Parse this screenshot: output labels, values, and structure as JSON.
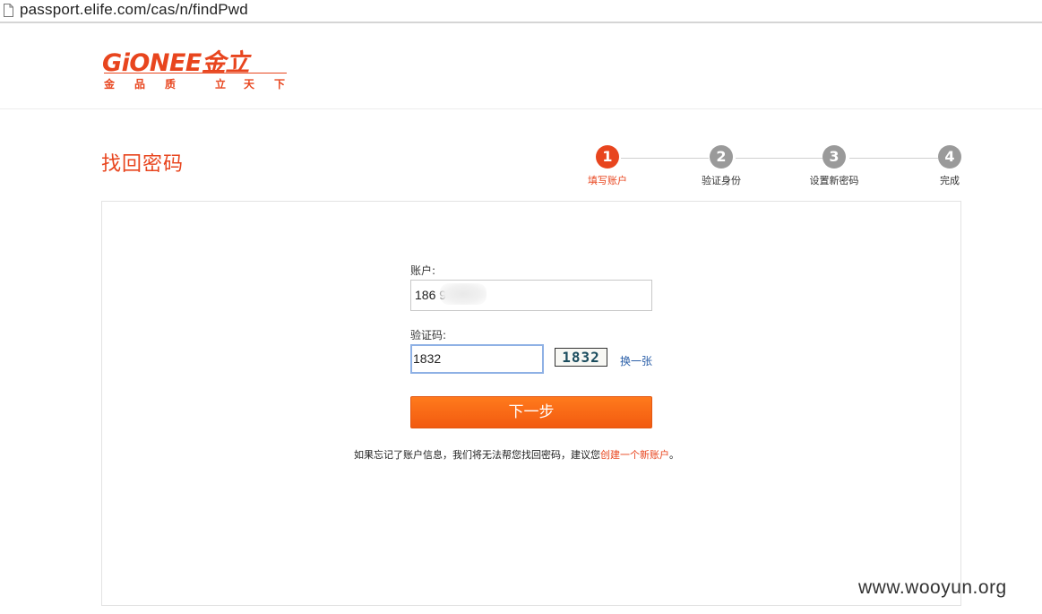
{
  "browser": {
    "url": "passport.elife.com/cas/n/findPwd"
  },
  "header": {
    "logo_text": "GiONEE金立",
    "slogan": [
      "金",
      "品",
      "质",
      "立",
      "天",
      "下"
    ]
  },
  "page": {
    "title": "找回密码"
  },
  "steps": [
    {
      "number": "1",
      "label": "填写账户",
      "state": "active"
    },
    {
      "number": "2",
      "label": "验证身份",
      "state": "inactive"
    },
    {
      "number": "3",
      "label": "设置新密码",
      "state": "inactive"
    },
    {
      "number": "4",
      "label": "完成",
      "state": "inactive"
    }
  ],
  "form": {
    "account_label": "账户:",
    "account_value": "186          9",
    "captcha_label": "验证码:",
    "captcha_value": "1832",
    "captcha_image_text": "1832",
    "refresh_label": "换一张",
    "next_label": "下一步",
    "hint_prefix": "如果忘记了账户信息，我们将无法帮您找回密码，建议您",
    "hint_link": "创建一个新账户",
    "hint_suffix": "。"
  },
  "watermark": "www.wooyun.org",
  "colors": {
    "brand": "#e8451e",
    "button": "#f76a16",
    "link": "#2b5fa8",
    "step_inactive": "#9a9a9a"
  }
}
